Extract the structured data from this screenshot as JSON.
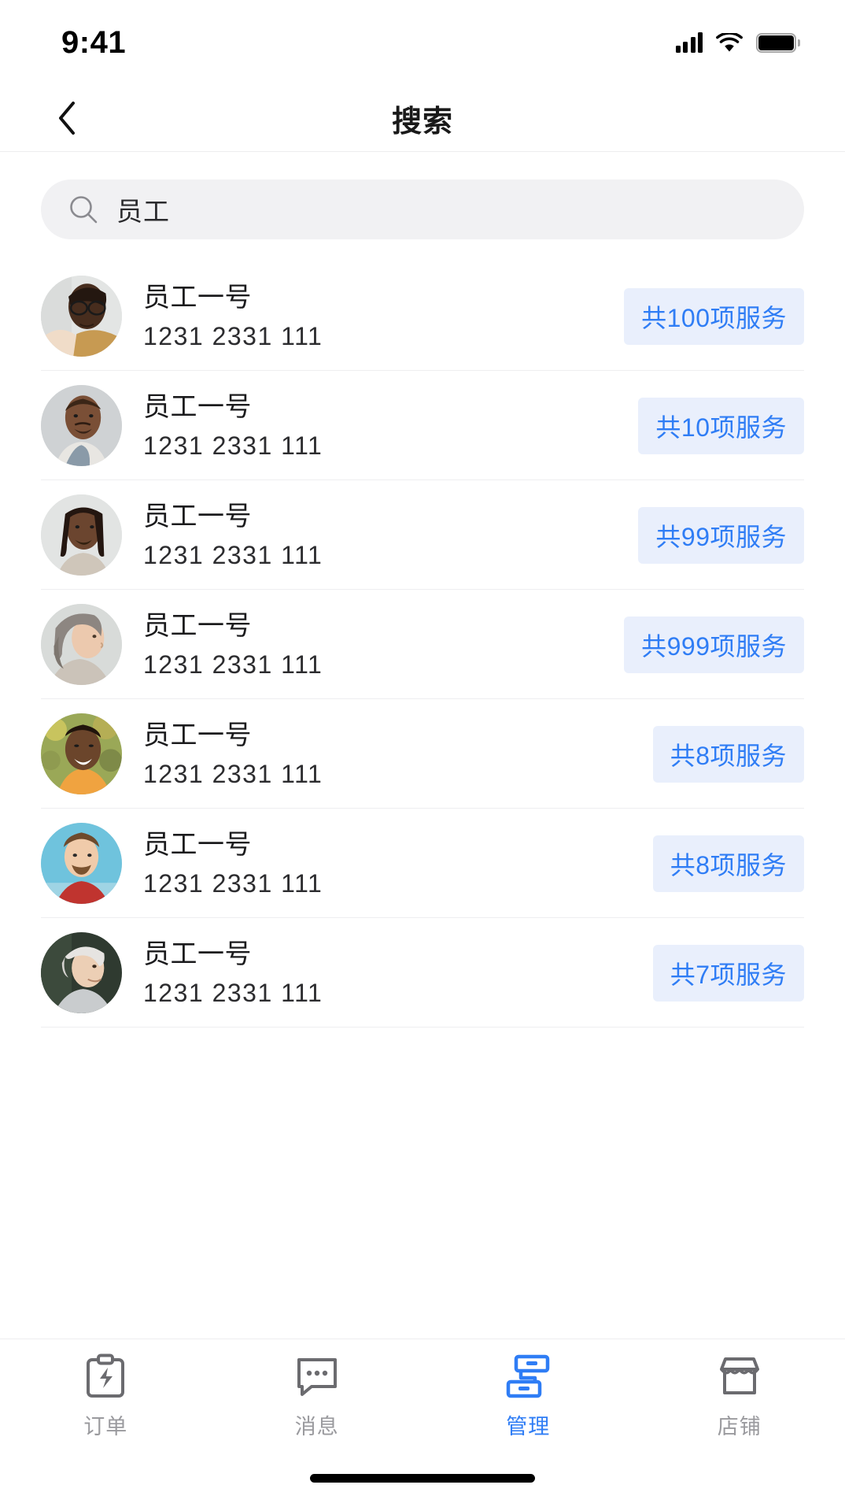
{
  "status_bar": {
    "time": "9:41",
    "signal_icon": "cellular-signal-icon",
    "wifi_icon": "wifi-icon",
    "battery_icon": "battery-full-icon"
  },
  "nav": {
    "back_icon": "chevron-left-icon",
    "title": "搜索"
  },
  "search": {
    "icon": "search-icon",
    "value": "员工",
    "placeholder": "员工"
  },
  "colors": {
    "accent": "#2f7df5",
    "badge_bg": "#e9effc",
    "badge_text": "#2f7df5",
    "search_bg": "#f1f1f3",
    "divider": "#eeeef0",
    "tab_inactive": "#9a9a9e",
    "text_primary": "#1b1b1d"
  },
  "list": {
    "items": [
      {
        "name": "员工一号",
        "phone": "1231 2331 111",
        "badge": "共100项服务",
        "avatar": "avatar-man-glasses"
      },
      {
        "name": "员工一号",
        "phone": "1231 2331 111",
        "badge": "共10项服务",
        "avatar": "avatar-man-bald-smiling"
      },
      {
        "name": "员工一号",
        "phone": "1231 2331 111",
        "badge": "共99项服务",
        "avatar": "avatar-man-dreadlocks"
      },
      {
        "name": "员工一号",
        "phone": "1231 2331 111",
        "badge": "共999项服务",
        "avatar": "avatar-woman-long-hair"
      },
      {
        "name": "员工一号",
        "phone": "1231 2331 111",
        "badge": "共8项服务",
        "avatar": "avatar-woman-laughing-outdoors"
      },
      {
        "name": "员工一号",
        "phone": "1231 2331 111",
        "badge": "共8项服务",
        "avatar": "avatar-man-beard-blue-sky"
      },
      {
        "name": "员工一号",
        "phone": "1231 2331 111",
        "badge": "共7项服务",
        "avatar": "avatar-woman-short-grey-hair"
      }
    ]
  },
  "tab_bar": {
    "items": [
      {
        "label": "订单",
        "icon": "clipboard-bolt-icon",
        "active": false
      },
      {
        "label": "消息",
        "icon": "message-dots-icon",
        "active": false
      },
      {
        "label": "管理",
        "icon": "org-chart-icon",
        "active": true
      },
      {
        "label": "店铺",
        "icon": "storefront-icon",
        "active": false
      }
    ]
  }
}
